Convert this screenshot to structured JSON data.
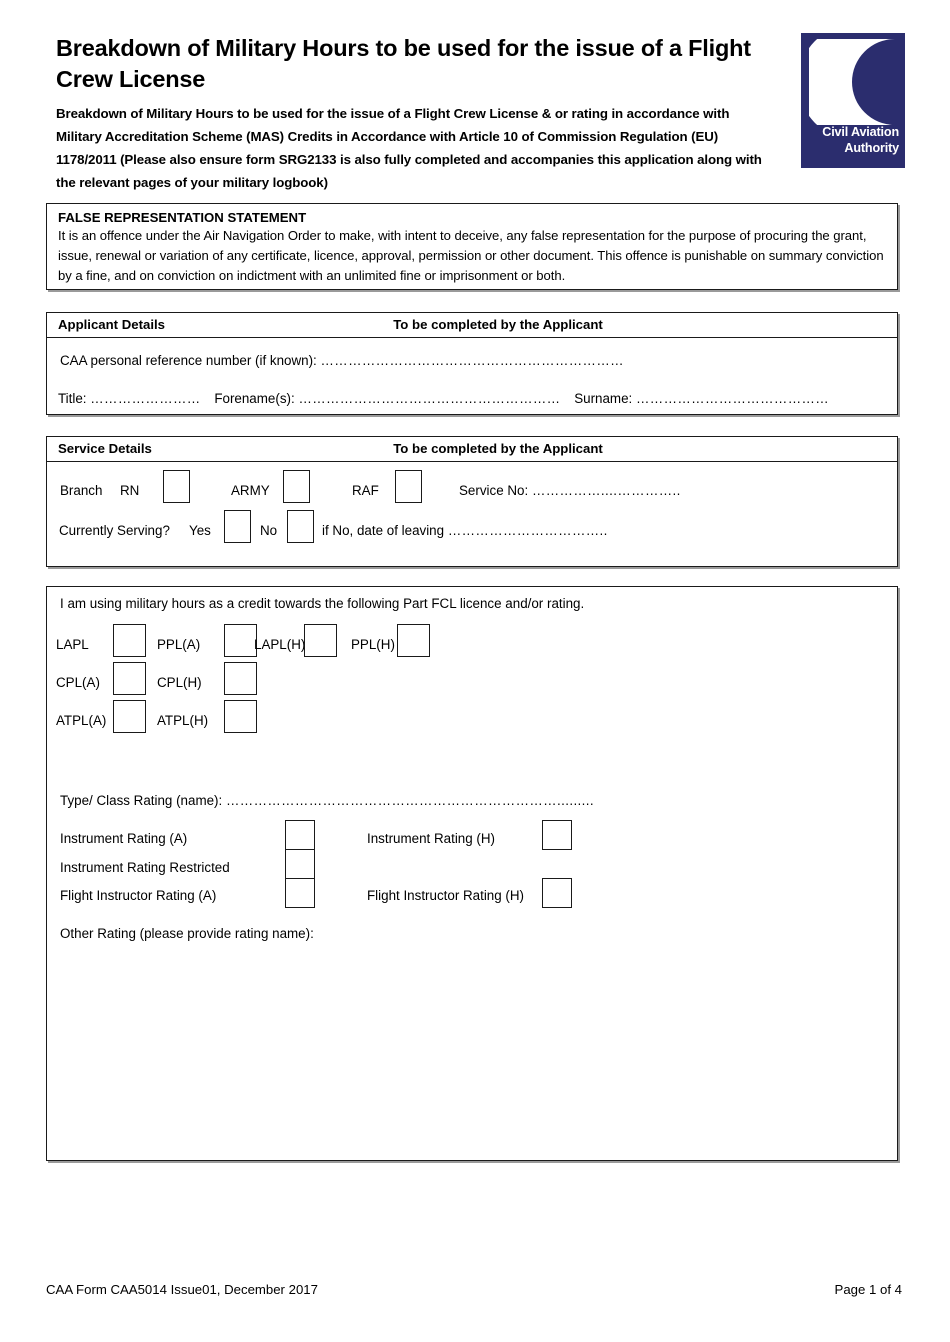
{
  "header": {
    "title": "Breakdown of Military Hours to be used for the issue of a Flight Crew License",
    "subtitle": "Breakdown of Military Hours to be used for the issue of a Flight Crew License & or rating in accordance with Military Accreditation Scheme (MAS) Credits in Accordance with Article 10 of Commission Regulation (EU) 1178/2011 (Please also ensure form SRG2133 is also fully completed and accompanies this application along with the relevant pages of your military logbook)",
    "logo": {
      "line1": "Civil Aviation",
      "line2": "Authority",
      "background_color": "#2b2d6e",
      "mark_color": "#ffffff"
    }
  },
  "false_representation": {
    "title": "FALSE REPRESENTATION STATEMENT",
    "body": "It is an offence under the Air Navigation Order to make, with intent to deceive, any false representation for the purpose of procuring the grant, issue, renewal or variation of any certificate, licence, approval, permission or other document. This offence is punishable on summary conviction by a fine, and on conviction on indictment with an unlimited fine or imprisonment or both."
  },
  "applicant_details": {
    "header_left": "Applicant Details",
    "header_right": "To be completed by the Applicant",
    "caa_ref_label": "CAA personal reference number (if known):",
    "caa_ref_dots": "…………………………………………………………",
    "title_label": "Title:",
    "title_dots": "……………………",
    "forename_label": "Forename(s):",
    "forename_dots": "…………………………………………………",
    "surname_label": "Surname:",
    "surname_dots": "……………………………………"
  },
  "service_details": {
    "header_left": "Service Details",
    "header_right": "To be completed by the Applicant",
    "branch_label": "Branch",
    "branch_options": [
      "RN",
      "ARMY",
      "RAF"
    ],
    "service_no_label": "Service No:",
    "service_no_dots": "……………....…………..",
    "currently_serving_label": "Currently Serving?",
    "yes_label": "Yes",
    "no_label": "No",
    "date_of_leaving_label": "if No, date of leaving",
    "date_of_leaving_dots": "……………………………..",
    "checkboxes": [
      "rn",
      "army",
      "raf",
      "yes",
      "no"
    ]
  },
  "fcl_section": {
    "intro": "I am using military hours as a credit towards the following Part FCL licence and/or rating.",
    "licences": [
      {
        "label": "LAPL",
        "row": 1,
        "col": 1
      },
      {
        "label": "PPL(A)",
        "row": 1,
        "col": 2
      },
      {
        "label": "LAPL(H)",
        "row": 1,
        "col": 3
      },
      {
        "label": "PPL(H)",
        "row": 1,
        "col": 4
      },
      {
        "label": "CPL(A)",
        "row": 2,
        "col": 1
      },
      {
        "label": "CPL(H)",
        "row": 2,
        "col": 2
      },
      {
        "label": "ATPL(A)",
        "row": 3,
        "col": 1
      },
      {
        "label": "ATPL(H)",
        "row": 3,
        "col": 2
      }
    ],
    "type_class_rating_label": "Type/ Class Rating (name):",
    "type_class_rating_dots": "……………………………………………………………….........",
    "ratings": [
      {
        "label": "Instrument Rating (A)",
        "side": "left"
      },
      {
        "label": "Instrument Rating (H)",
        "side": "right"
      },
      {
        "label": "Instrument Rating Restricted",
        "side": "left"
      },
      {
        "label": "Flight Instructor Rating (A)",
        "side": "left"
      },
      {
        "label": "Flight Instructor Rating (H)",
        "side": "right"
      }
    ],
    "other_rating_label": "Other Rating (please provide rating name):"
  },
  "footer": {
    "form_reference": "CAA Form CAA5014 Issue01, December 2017",
    "page_number": "Page 1 of 4"
  }
}
